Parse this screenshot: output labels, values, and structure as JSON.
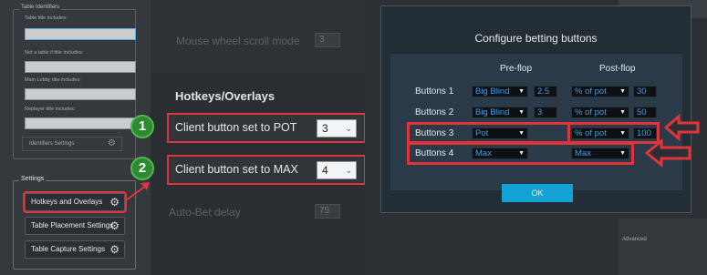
{
  "left_panel": {
    "table_ident_legend": "Table Identifiers",
    "fields": [
      {
        "label": "Table title includes:",
        "value": ""
      },
      {
        "label": "Not a table if title includes:",
        "value": ""
      },
      {
        "label": "Main Lobby title includes:",
        "value": ""
      },
      {
        "label": "Replayer title includes:",
        "value": ""
      }
    ],
    "identifiers_settings_label": "Identifiers Settings",
    "settings_legend": "Settings",
    "settings_buttons": [
      {
        "label": "Hotkeys and Overlays"
      },
      {
        "label": "Table Placement Settings"
      },
      {
        "label": "Table Capture Settings"
      }
    ]
  },
  "middle": {
    "faded_rows": [
      {
        "label": "Mouse wheel scroll mode",
        "value": "3"
      },
      {
        "label": "Auto-Bet delay",
        "value": "75"
      }
    ],
    "section_title": "Hotkeys/Overlays",
    "hotkeys": [
      {
        "badge": "1",
        "label": "Client button set to POT",
        "value": "3"
      },
      {
        "badge": "2",
        "label": "Client button set to MAX",
        "value": "4"
      }
    ]
  },
  "dialog": {
    "title": "Configure betting buttons",
    "col_preflop": "Pre-flop",
    "col_postflop": "Post-flop",
    "rows": [
      {
        "label": "Buttons 1",
        "pre_type": "Big Blind",
        "pre_value": "2.5",
        "post_type": "% of pot",
        "post_value": "30"
      },
      {
        "label": "Buttons 2",
        "pre_type": "Big Blind",
        "pre_value": "3",
        "post_type": "% of pot",
        "post_value": "50"
      },
      {
        "label": "Buttons 3",
        "pre_type": "Pot",
        "pre_value": "",
        "post_type": "% of pot",
        "post_value": "100"
      },
      {
        "label": "Buttons 4",
        "pre_type": "Max",
        "pre_value": "",
        "post_type": "Max",
        "post_value": ""
      }
    ],
    "ok_label": "OK"
  },
  "right_strip": {
    "advanced_label": "Advanced"
  },
  "colors": {
    "highlight_red": "#e0343c",
    "badge_green": "#2e8a2e",
    "accent_blue": "#14a1d6"
  }
}
